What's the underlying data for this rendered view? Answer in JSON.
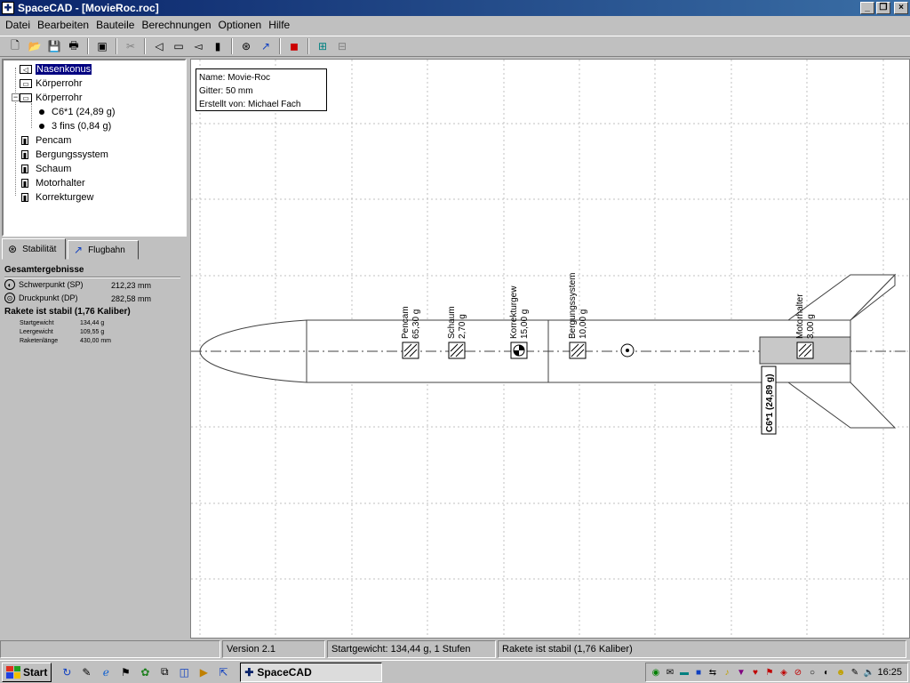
{
  "window": {
    "title": "SpaceCAD - [MovieRoc.roc]",
    "controls": [
      "minimize-icon",
      "restore-icon",
      "close-icon"
    ]
  },
  "menu": [
    {
      "label": "Datei"
    },
    {
      "label": "Bearbeiten"
    },
    {
      "label": "Bauteile"
    },
    {
      "label": "Berechnungen"
    },
    {
      "label": "Optionen"
    },
    {
      "label": "Hilfe"
    }
  ],
  "toolbar": [
    "new-icon",
    "open-icon",
    "save-icon",
    "print-icon",
    "properties-icon",
    "cut-icon",
    "nosecone-icon",
    "bodytube-icon",
    "fins-icon",
    "mass-icon",
    "stability-icon",
    "flightpath-icon",
    "export-icon",
    "align-icon",
    "grid-icon"
  ],
  "tree": {
    "items": [
      {
        "label": "Nasenkonus",
        "selected": true
      },
      {
        "label": "Körperrohr"
      },
      {
        "label": "Körperrohr",
        "expanded": true
      },
      {
        "label": "C6*1 (24,89 g)"
      },
      {
        "label": "3 fins (0,84 g)"
      },
      {
        "label": "Pencam"
      },
      {
        "label": "Bergungssystem"
      },
      {
        "label": "Schaum"
      },
      {
        "label": "Motorhalter"
      },
      {
        "label": "Korrekturgew"
      }
    ]
  },
  "tabs": [
    {
      "label": "Stabilität",
      "active": true
    },
    {
      "label": "Flugbahn"
    }
  ],
  "results": {
    "heading": "Gesamtergebnisse",
    "cg_label": "Schwerpunkt (SP)",
    "cg_value": "212,23 mm",
    "cp_label": "Druckpunkt (DP)",
    "cp_value": "282,58 mm",
    "stable": "Rakete ist stabil (1,76 Kaliber)",
    "details": [
      {
        "label": "Startgewicht",
        "value": "134,44 g"
      },
      {
        "label": "Leergewicht",
        "value": "109,55 g"
      },
      {
        "label": "Raketenlänge",
        "value": "430,00 mm"
      }
    ]
  },
  "info": {
    "name": "Name: Movie-Roc",
    "grid": "Gitter: 50 mm",
    "author": "Erstellt von: Michael Fach"
  },
  "drawing": {
    "components": [
      {
        "name": "Pencam",
        "mass": "65,30 g"
      },
      {
        "name": "Schaum",
        "mass": "2,70 g"
      },
      {
        "name": "Korrekturgew",
        "mass": "15,00 g"
      },
      {
        "name": "Bergungssystem",
        "mass": "10,00 g"
      },
      {
        "name": "Motorhalter",
        "mass": "3,00 g"
      }
    ],
    "motor": "C6*1 (24,89 g)"
  },
  "status": {
    "blank": "",
    "version": "Version 2.1",
    "weight": "Startgewicht: 134,44 g, 1 Stufen",
    "stable": "Rakete ist stabil (1,76 Kaliber)"
  },
  "taskbar": {
    "start": "Start",
    "app": "SpaceCAD",
    "clock": "16:25"
  }
}
